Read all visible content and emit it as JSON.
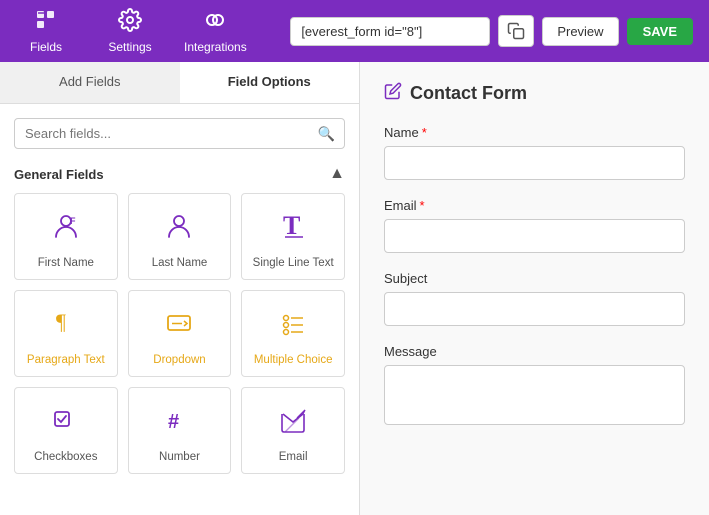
{
  "header": {
    "nav": [
      {
        "id": "fields",
        "label": "Fields",
        "icon": "fields"
      },
      {
        "id": "settings",
        "label": "Settings",
        "icon": "settings"
      },
      {
        "id": "integrations",
        "label": "Integrations",
        "icon": "integrations"
      }
    ],
    "shortcode": "[everest_form id=\"8\"]",
    "preview_label": "Preview",
    "save_label": "SAVE"
  },
  "left_panel": {
    "tabs": [
      {
        "id": "add-fields",
        "label": "Add Fields",
        "active": false
      },
      {
        "id": "field-options",
        "label": "Field Options",
        "active": true
      }
    ],
    "search_placeholder": "Search fields...",
    "section_label": "General Fields",
    "fields": [
      {
        "id": "first-name",
        "label": "First Name",
        "icon": "person-f"
      },
      {
        "id": "last-name",
        "label": "Last Name",
        "icon": "person"
      },
      {
        "id": "single-line-text",
        "label": "Single Line Text",
        "icon": "text-t"
      },
      {
        "id": "paragraph-text",
        "label": "Paragraph Text",
        "icon": "paragraph",
        "color": "gold"
      },
      {
        "id": "dropdown",
        "label": "Dropdown",
        "icon": "dropdown",
        "color": "gold"
      },
      {
        "id": "multiple-choice",
        "label": "Multiple Choice",
        "icon": "multiple-choice",
        "color": "gold"
      },
      {
        "id": "checkboxes",
        "label": "Checkboxes",
        "icon": "checkboxes"
      },
      {
        "id": "number",
        "label": "Number",
        "icon": "number"
      },
      {
        "id": "email",
        "label": "Email",
        "icon": "email-field"
      }
    ]
  },
  "right_panel": {
    "form_title": "Contact Form",
    "form_fields": [
      {
        "id": "name",
        "label": "Name",
        "required": true,
        "type": "input"
      },
      {
        "id": "email",
        "label": "Email",
        "required": true,
        "type": "input"
      },
      {
        "id": "subject",
        "label": "Subject",
        "required": false,
        "type": "input"
      },
      {
        "id": "message",
        "label": "Message",
        "required": false,
        "type": "textarea"
      }
    ]
  }
}
